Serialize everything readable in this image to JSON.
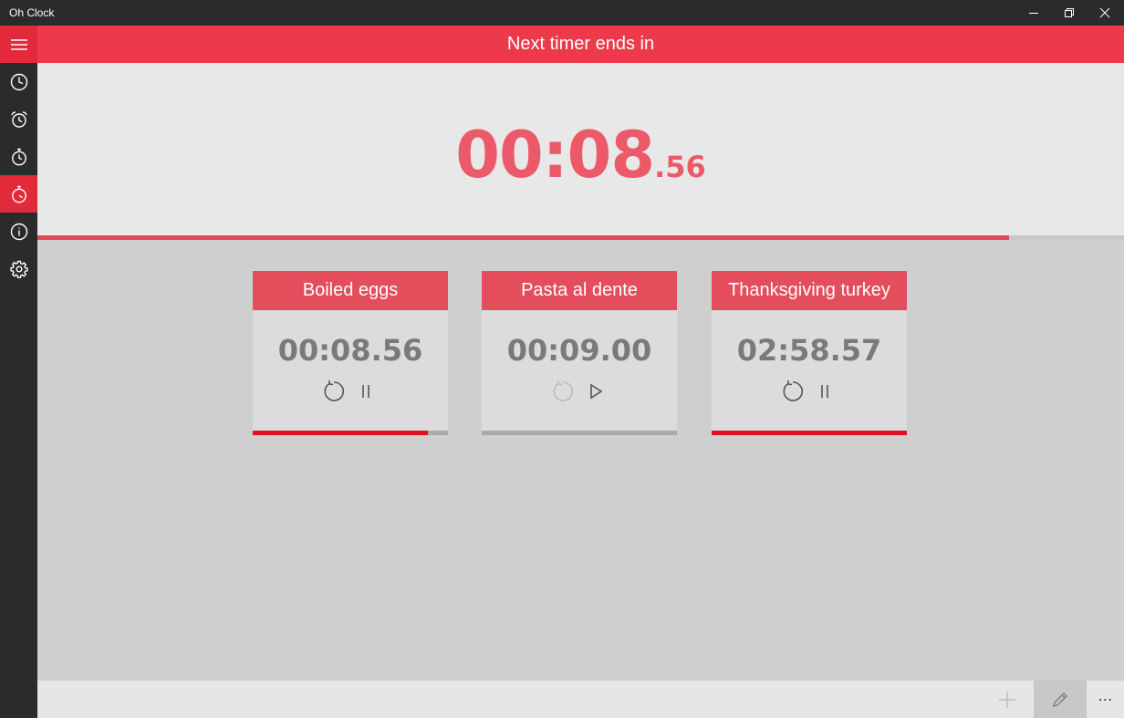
{
  "window": {
    "title": "Oh Clock"
  },
  "sidebar": {
    "items": [
      {
        "icon": "hamburger-menu-icon",
        "active": false
      },
      {
        "icon": "clock-icon",
        "active": false
      },
      {
        "icon": "alarm-icon",
        "active": false
      },
      {
        "icon": "stopwatch-icon",
        "active": false
      },
      {
        "icon": "timer-icon",
        "active": true
      },
      {
        "icon": "info-icon",
        "active": false
      },
      {
        "icon": "gear-icon",
        "active": false
      }
    ]
  },
  "header": {
    "title": "Next timer ends in"
  },
  "next_timer": {
    "main": "00:08",
    "fraction": ".56",
    "progress": 0.894
  },
  "timers": [
    {
      "name": "Boiled eggs",
      "time": "00:08.56",
      "state": "running",
      "progress": 0.897
    },
    {
      "name": "Pasta al dente",
      "time": "00:09.00",
      "state": "paused",
      "progress": 0.0
    },
    {
      "name": "Thanksgiving turkey",
      "time": "02:58.57",
      "state": "running",
      "progress": 1.0
    }
  ],
  "appbar": {
    "add": "add-icon",
    "edit": "pencil-icon",
    "more": "⋯"
  },
  "colors": {
    "accent": "#ec3a4a",
    "big_time": "#ec5a6a",
    "card_header": "#e44d5c",
    "card_progress": "#e0101e",
    "sidebar": "#2b2b2b"
  }
}
